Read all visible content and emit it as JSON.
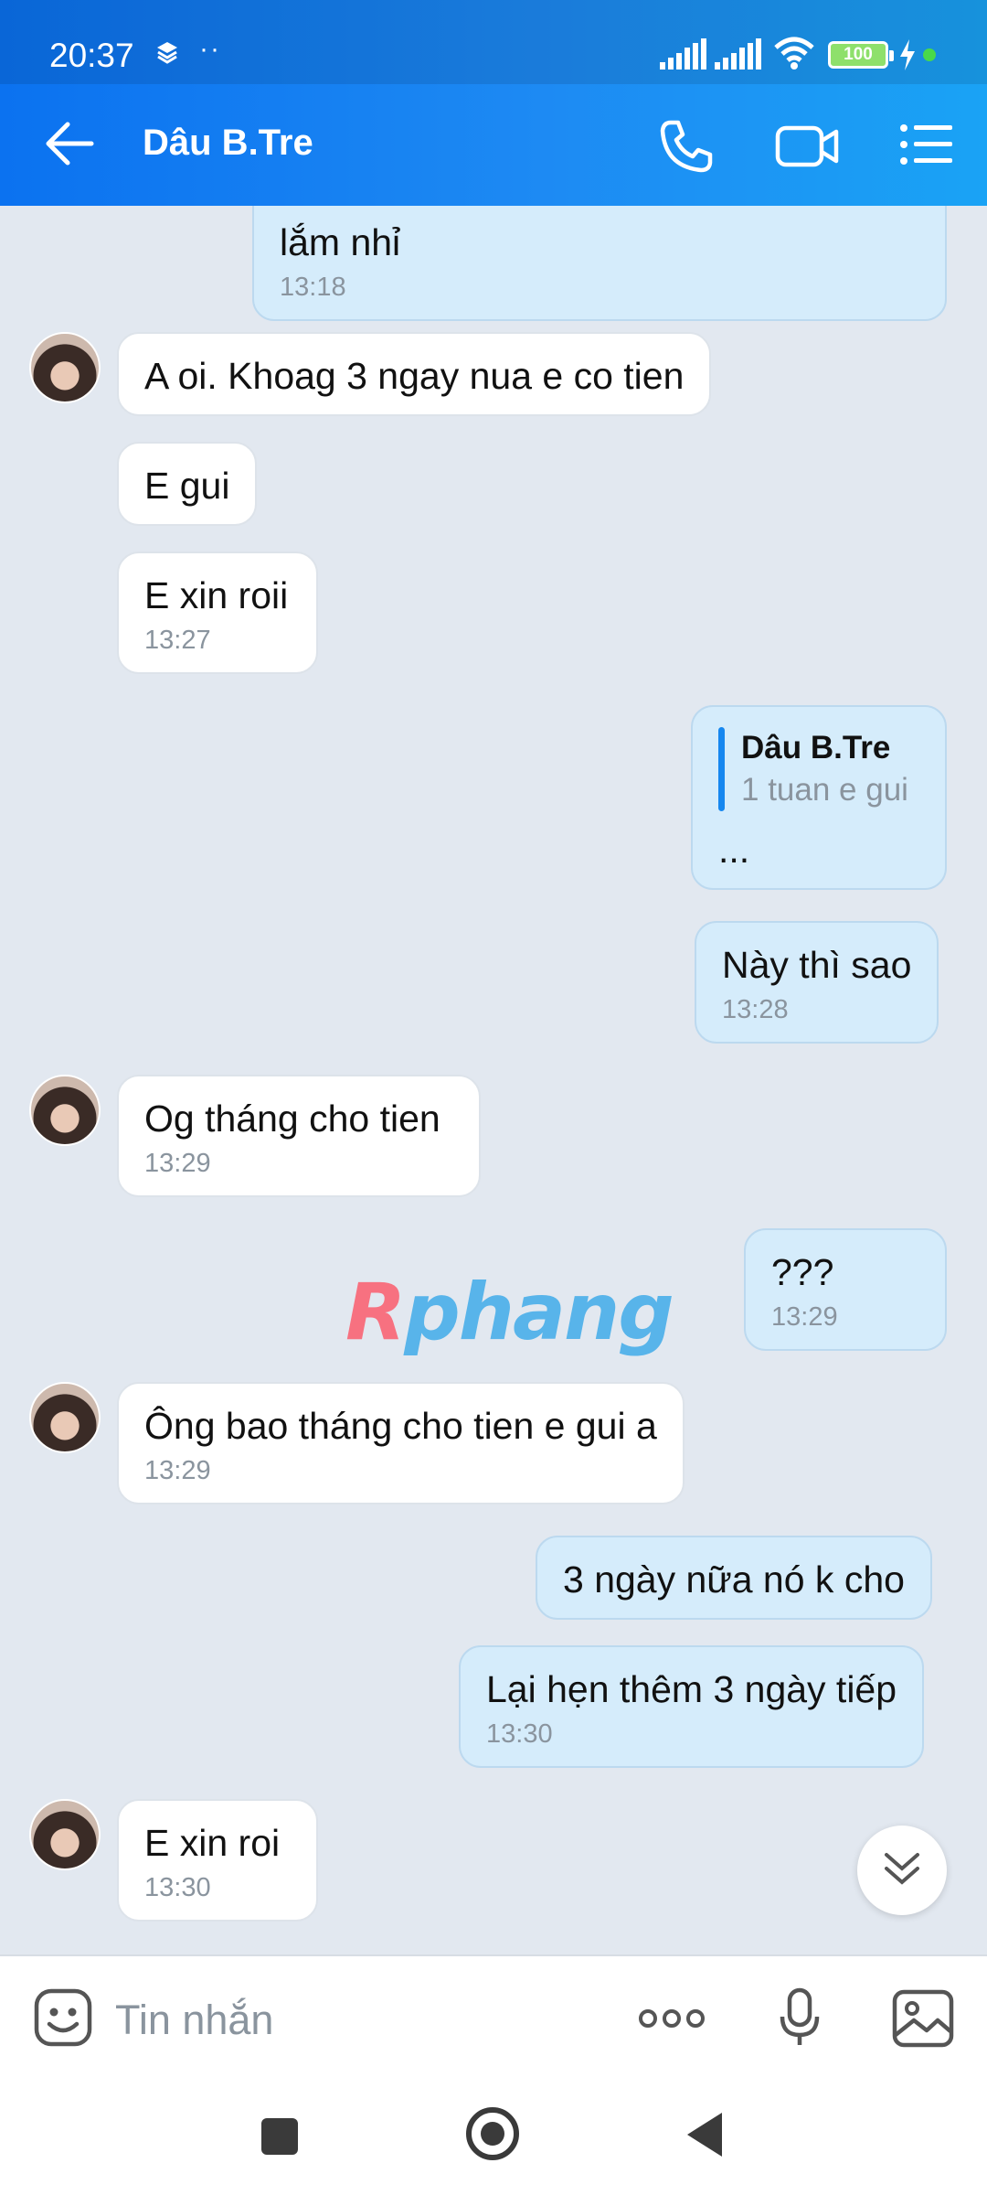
{
  "status_bar": {
    "time": "20:37",
    "dots": "··",
    "battery": "100"
  },
  "header": {
    "title": "Dâu B.Tre"
  },
  "messages": [
    {
      "dir": "out",
      "text": "lắm nhỉ",
      "time": "13:18"
    },
    {
      "dir": "in",
      "text": "A oi. Khoag 3 ngay nua e co tien",
      "time": ""
    },
    {
      "dir": "in",
      "text": "E gui",
      "time": ""
    },
    {
      "dir": "in",
      "text": "E xin roii",
      "time": "13:27"
    },
    {
      "dir": "out",
      "reply_name": "Dâu B.Tre",
      "reply_text": "1 tuan e gui",
      "text": "...",
      "time": ""
    },
    {
      "dir": "out",
      "text": "Này thì sao",
      "time": "13:28"
    },
    {
      "dir": "in",
      "text": "Og tháng cho tien",
      "time": "13:29"
    },
    {
      "dir": "out",
      "text": "???",
      "time": "13:29"
    },
    {
      "dir": "in",
      "text": "Ông bao tháng cho tien e gui a",
      "time": "13:29"
    },
    {
      "dir": "out",
      "text": "3 ngày nữa nó k cho",
      "time": ""
    },
    {
      "dir": "out",
      "text": "Lại hẹn thêm 3 ngày tiếp",
      "time": "13:30"
    },
    {
      "dir": "in",
      "text": "E xin roi",
      "time": "13:30"
    }
  ],
  "watermark": {
    "lead": "R",
    "rest": "phang"
  },
  "input": {
    "placeholder": "Tin nhắn"
  },
  "icons": {
    "back": "arrow-left-icon",
    "call": "phone-icon",
    "video": "video-camera-icon",
    "menu": "list-menu-icon",
    "emoji": "sticker-icon",
    "more": "more-dots-icon",
    "mic": "microphone-icon",
    "gallery": "image-icon",
    "scroll": "double-chevron-down-icon"
  },
  "colors": {
    "header": "#1d8af3",
    "bubble_out": "#d5ecfb",
    "bubble_in": "#ffffff",
    "background": "#e2e8f0"
  }
}
